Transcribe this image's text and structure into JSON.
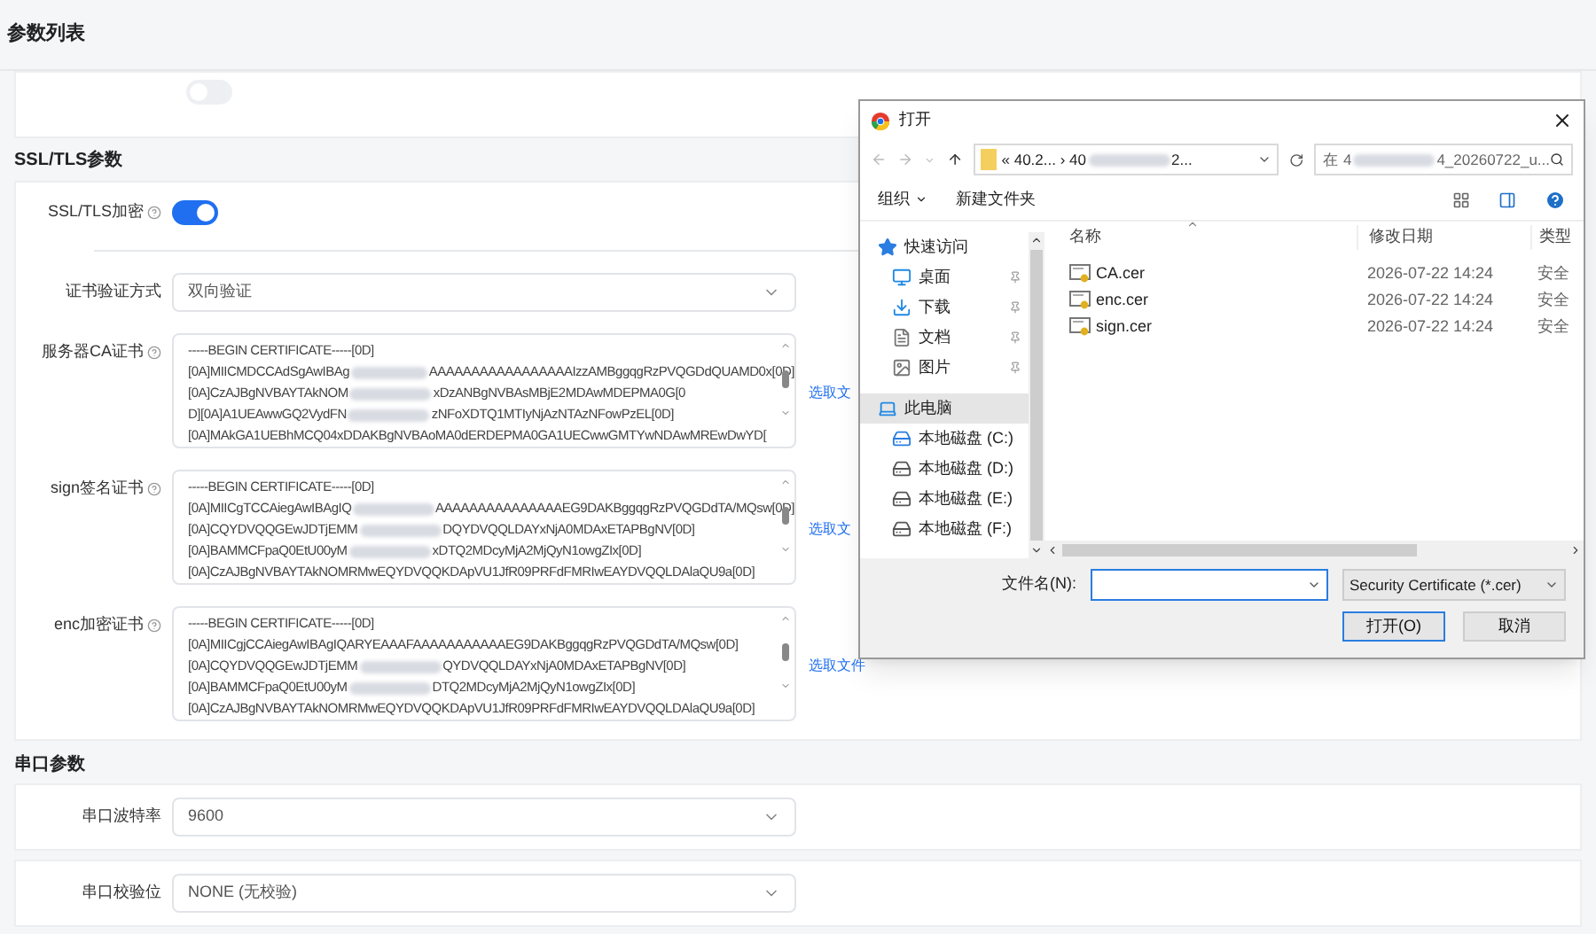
{
  "page_title": "参数列表",
  "top_toggle": {
    "on": false
  },
  "ssl_section": {
    "title": "SSL/TLS参数",
    "encryption": {
      "label": "SSL/TLS加密",
      "on": true
    },
    "verify_mode": {
      "label": "证书验证方式",
      "value": "双向验证"
    },
    "certificates": [
      {
        "label": "服务器CA证书",
        "link": "选取文",
        "lines": [
          [
            "-----BEGIN CERTIFICATE-----[0D]"
          ],
          [
            "[0A]MIICMDCCAdSgAwIBAg",
            "AAAAAAAAAAAAAAAAAIzzAMBggqgRzPVQGDdQUAMD0x[0D]"
          ],
          [
            "[0A]CzAJBgNVBAYTAkNOM",
            "xDzANBgNVBAsMBjE2MDAwMDEPMA0G[0"
          ],
          [
            "D][0A]A1UEAwwGQ2VydFN",
            "zNFoXDTQ1MTIyNjAzNTAzNFowPzEL[0D]"
          ],
          [
            "[0A]MAkGA1UEBhMCQ04xDDAKBgNVBAoMA0dERDEPMA0GA1UECwwGMTYwNDAwMREwDwYD["
          ]
        ]
      },
      {
        "label": "sign签名证书",
        "link": "选取文",
        "lines": [
          [
            "-----BEGIN CERTIFICATE-----[0D]"
          ],
          [
            "[0A]MIICgTCCAiegAwIBAgIQ",
            "AAAAAAAAAAAAAAAEG9DAKBggqgRzPVQGDdTA/MQsw[0D]"
          ],
          [
            "[0A]CQYDVQQGEwJDTjEMM",
            "DQYDVQQLDAYxNjA0MDAxETAPBgNV[0D]"
          ],
          [
            "[0A]BAMMCFpaQ0EtU00yM",
            "xDTQ2MDcyMjA2MjQyN1owgZIx[0D]"
          ],
          [
            "[0A]CzAJBgNVBAYTAkNOMRMwEQYDVQQKDApVU1JfR09PRFdFMRIwEAYDVQQLDAlaQU9a[0D]"
          ]
        ]
      },
      {
        "label": "enc加密证书",
        "link": "选取文件",
        "lines": [
          [
            "-----BEGIN CERTIFICATE-----[0D]"
          ],
          [
            "[0A]MIICgjCCAiegAwIBAgIQARYEAAAFAAAAAAAAAAAEG9DAKBggqgRzPVQGDdTA/MQsw[0D]"
          ],
          [
            "[0A]CQYDVQQGEwJDTjEMM",
            "QYDVQQLDAYxNjA0MDAxETAPBgNV[0D]"
          ],
          [
            "[0A]BAMMCFpaQ0EtU00yM",
            "DTQ2MDcyMjA2MjQyN1owgZIx[0D]"
          ],
          [
            "[0A]CzAJBgNVBAYTAkNOMRMwEQYDVQQKDApVU1JfR09PRFdFMRIwEAYDVQQLDAlaQU9a[0D]"
          ]
        ]
      }
    ]
  },
  "serial_section": {
    "title": "串口参数",
    "fields": [
      {
        "label": "串口波特率",
        "value": "9600"
      },
      {
        "label": "串口校验位",
        "value": "NONE (无校验)"
      }
    ]
  },
  "dialog": {
    "title": "打开",
    "path": [
      "« 40.2... › 40",
      "2..."
    ],
    "search": [
      "在 4",
      "4_20260722_u..."
    ],
    "toolbar": {
      "organize": "组织",
      "new_folder": "新建文件夹"
    },
    "nav": [
      {
        "label": "快速访问",
        "kind": "star",
        "selected": false,
        "children": [
          {
            "label": "桌面",
            "kind": "desktop",
            "pinned": true,
            "selected": false
          },
          {
            "label": "下载",
            "kind": "download",
            "pinned": true,
            "selected": false
          },
          {
            "label": "文档",
            "kind": "document",
            "pinned": true,
            "selected": false
          },
          {
            "label": "图片",
            "kind": "picture",
            "pinned": true,
            "selected": false
          }
        ]
      },
      {
        "label": "此电脑",
        "kind": "pc",
        "selected": true,
        "children": [
          {
            "label": "本地磁盘 (C:)",
            "kind": "system_drive",
            "pinned": false,
            "selected": false
          },
          {
            "label": "本地磁盘 (D:)",
            "kind": "drive",
            "pinned": false,
            "selected": false
          },
          {
            "label": "本地磁盘 (E:)",
            "kind": "drive",
            "pinned": false,
            "selected": false
          },
          {
            "label": "本地磁盘 (F:)",
            "kind": "drive",
            "pinned": false,
            "selected": false
          }
        ]
      }
    ],
    "columns": [
      "名称",
      "修改日期",
      "类型"
    ],
    "files": [
      {
        "name": "CA.cer",
        "date": "2026-07-22 14:24",
        "type": "安全"
      },
      {
        "name": "enc.cer",
        "date": "2026-07-22 14:24",
        "type": "安全"
      },
      {
        "name": "sign.cer",
        "date": "2026-07-22 14:24",
        "type": "安全"
      }
    ],
    "filename_label": "文件名(N):",
    "filter": "Security Certificate (*.cer)",
    "open_button": "打开(O)",
    "cancel_button": "取消"
  }
}
